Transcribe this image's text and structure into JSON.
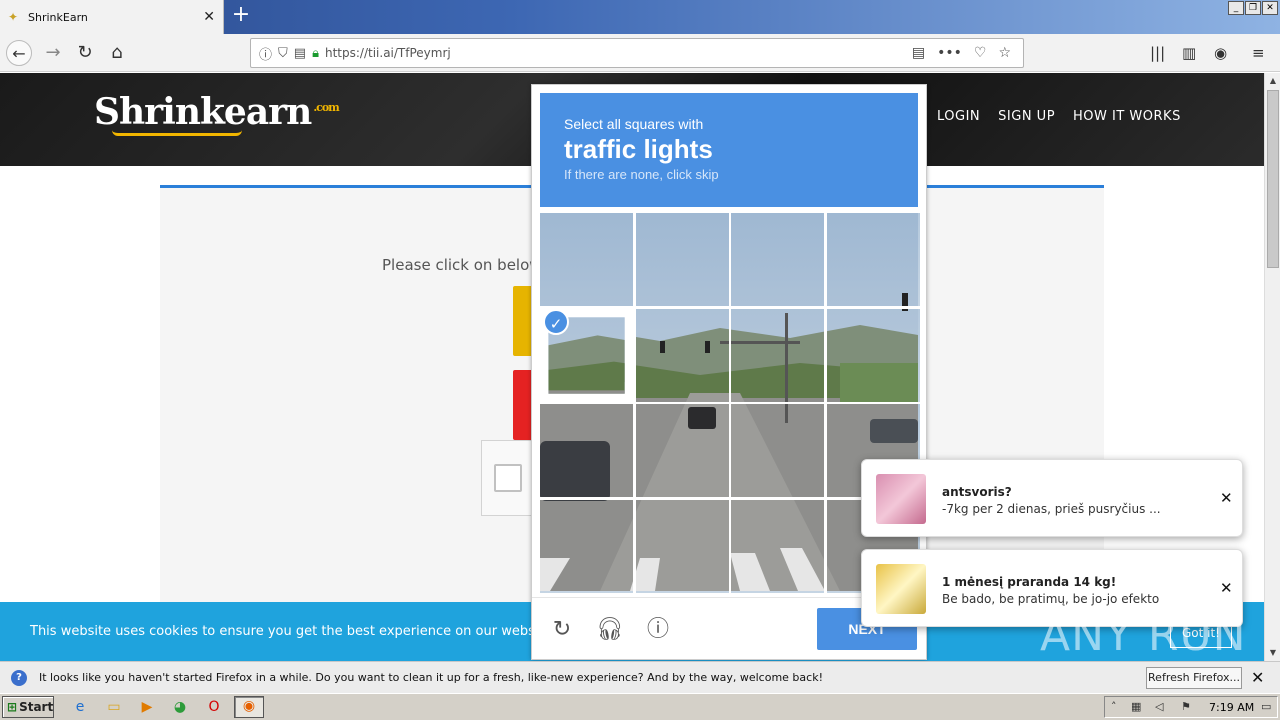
{
  "browser": {
    "tab_title": "ShrinkEarn",
    "new_tab_symbol": "+",
    "url": "https://tii.ai/TfPeymrj",
    "window_controls": [
      "_",
      "❐",
      "✕"
    ]
  },
  "site": {
    "logo_text": "Shrinkearn",
    "logo_suffix": ".com",
    "nav": [
      "LOGIN",
      "SIGN UP",
      "HOW IT WORKS"
    ],
    "prompt": "Please click on below",
    "cookie_text": "This website uses cookies to ensure you get the best experience on our website. Le",
    "cookie_button": "Got it!"
  },
  "captcha": {
    "header_line1": "Select all squares with",
    "header_line2": "traffic lights",
    "header_line3": "If there are none, click skip",
    "selected_tiles": [
      4
    ],
    "next_label": "NEXT",
    "colors": {
      "accent": "#4a90e2"
    }
  },
  "notifications": [
    {
      "title": "antsvoris?",
      "body": "-7kg per 2 dienas, prieš pusryčius ..."
    },
    {
      "title": "1 mėnesį praranda 14 kg!",
      "body": "Be bado, be pratimų, be jo-jo efekto"
    }
  ],
  "firefox_bar": {
    "message": "It looks like you haven't started Firefox in a while. Do you want to clean it up for a fresh, like-new experience? And by the way, welcome back!",
    "button": "Refresh Firefox..."
  },
  "taskbar": {
    "start_label": "Start",
    "clock": "7:19 AM"
  },
  "watermark": "ANY RUN"
}
